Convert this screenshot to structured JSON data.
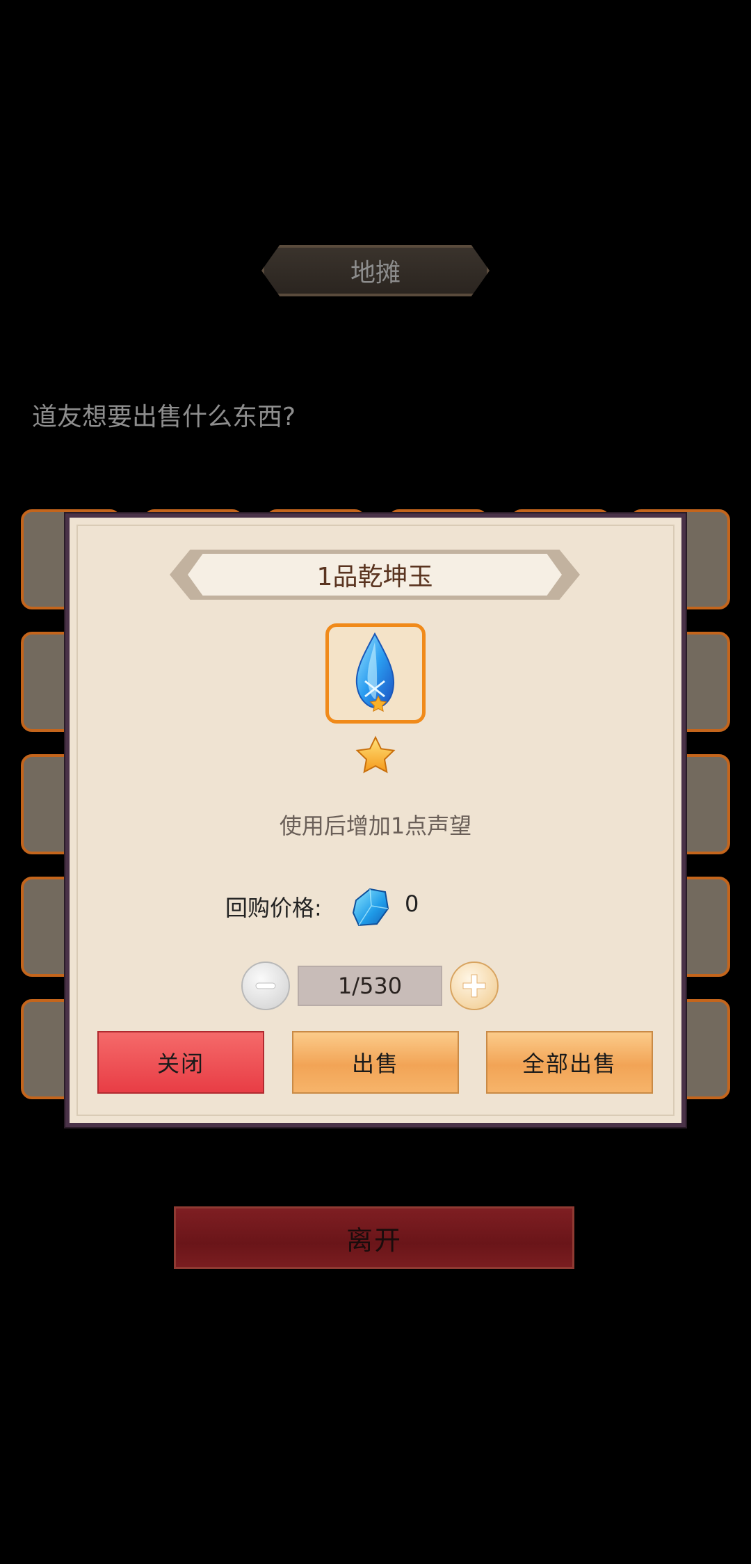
{
  "screen": {
    "title": "地摊",
    "question": "道友想要出售什么东西?",
    "leave_label": "离开",
    "grid": {
      "rows": 5,
      "cols": 6
    }
  },
  "dialog": {
    "item_name": "1品乾坤玉",
    "item_icon": "blue-crystal-icon",
    "star_count": 1,
    "description": "使用后增加1点声望",
    "price_label": "回购价格:",
    "price_icon": "blue-gem-icon",
    "price_value": "0",
    "quantity": "1/530",
    "buttons": {
      "close": "关闭",
      "sell": "出售",
      "sell_all": "全部出售"
    }
  },
  "colors": {
    "dialog_bg": "#efe3d2",
    "dialog_border": "#4a3248",
    "slot_border": "#c4651c",
    "close_red": "#e83d45",
    "sell_orange": "#f2a456",
    "leave_red": "#6a1519"
  }
}
